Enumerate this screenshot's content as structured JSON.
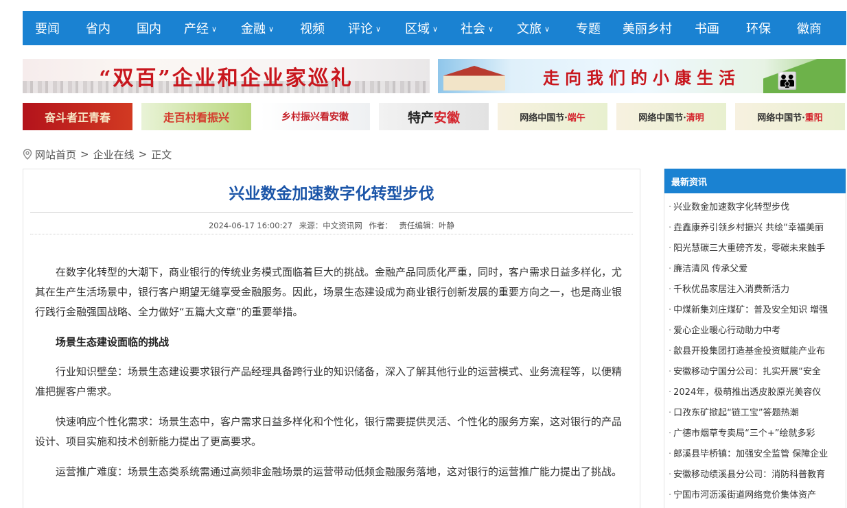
{
  "nav": {
    "items": [
      {
        "label": "要闻",
        "dropdown": false
      },
      {
        "label": "省内",
        "dropdown": false
      },
      {
        "label": "国内",
        "dropdown": false
      },
      {
        "label": "产经",
        "dropdown": true
      },
      {
        "label": "金融",
        "dropdown": true
      },
      {
        "label": "视频",
        "dropdown": false
      },
      {
        "label": "评论",
        "dropdown": true
      },
      {
        "label": "区域",
        "dropdown": true
      },
      {
        "label": "社会",
        "dropdown": true
      },
      {
        "label": "文旅",
        "dropdown": true
      },
      {
        "label": "专题",
        "dropdown": false
      },
      {
        "label": "美丽乡村",
        "dropdown": false
      },
      {
        "label": "书画",
        "dropdown": false
      },
      {
        "label": "环保",
        "dropdown": false
      },
      {
        "label": "徽商",
        "dropdown": false
      }
    ]
  },
  "banners": {
    "big_left": "“双百”企业和企业家巡礼",
    "big_right": "走向我们的小康生活",
    "small": [
      {
        "text": "奋斗者正青春"
      },
      {
        "text": "走百村看振兴"
      },
      {
        "text": "乡村振兴看安徽"
      },
      {
        "text_a": "特产",
        "text_b": "安徽"
      },
      {
        "text_a": "网络中国节·",
        "text_b": "端午"
      },
      {
        "text_a": "网络中国节·",
        "text_b": "清明"
      },
      {
        "text_a": "网络中国节·",
        "text_b": "重阳"
      }
    ]
  },
  "breadcrumb": {
    "home": "网站首页",
    "section": "企业在线",
    "current": "正文",
    "separator": ">"
  },
  "article": {
    "title": "兴业数金加速数字化转型步伐",
    "date": "2024-06-17 16:00:27",
    "source": "来源：中文资讯网",
    "author": "作者：",
    "editor": "责任编辑：叶静",
    "paragraphs": [
      {
        "type": "text",
        "text": "在数字化转型的大潮下，商业银行的传统业务模式面临着巨大的挑战。金融产品同质化严重，同时，客户需求日益多样化，尤其在生产生活场景中，银行客户期望无缝享受金融服务。因此，场景生态建设成为商业银行创新发展的重要方向之一，也是商业银行践行金融强国战略、全力做好“五篇大文章”的重要举措。"
      },
      {
        "type": "heading",
        "text": "场景生态建设面临的挑战"
      },
      {
        "type": "text",
        "text": "行业知识壁垒：场景生态建设要求银行产品经理具备跨行业的知识储备，深入了解其他行业的运营模式、业务流程等，以便精准把握客户需求。"
      },
      {
        "type": "text",
        "text": "快速响应个性化需求：场景生态中，客户需求日益多样化和个性化，银行需要提供灵活、个性化的服务方案，这对银行的产品设计、项目实施和技术创新能力提出了更高要求。"
      },
      {
        "type": "text",
        "text": "运营推广难度：场景生态类系统需通过高频非金融场景的运营带动低频金融服务落地，这对银行的运营推广能力提出了挑战。"
      }
    ]
  },
  "sidebar": {
    "title": "最新资讯",
    "items": [
      "兴业数金加速数字化转型步伐",
      "垚鑫康养引领乡村振兴 共绘“幸福美丽",
      "阳光慧碳三大重磅齐发，零碳未来触手",
      "廉洁清风 传承父爱",
      "千秋优品家居注入消费新活力",
      "中煤新集刘庄煤矿：普及安全知识 增强",
      "爱心企业暖心行动助力中考",
      "歙县开投集团打造基金投资赋能产业布",
      "安徽移动宁国分公司：扎实开展“安全",
      "2024年，极萌推出透皮胶原光美容仪",
      "口孜东矿掀起“链工宝”答题热潮",
      "广德市烟草专卖局“三个+”绘就多彩",
      "郎溪县毕桥镇：加强安全监管 保障企业",
      "安徽移动绩溪县分公司：消防科普教育",
      "宁国市河沥溪街道网络竞价集体资产"
    ]
  },
  "colors": {
    "nav_bg": "#1a82d2",
    "title": "#1b55a8",
    "banner_red": "#c8161d"
  }
}
